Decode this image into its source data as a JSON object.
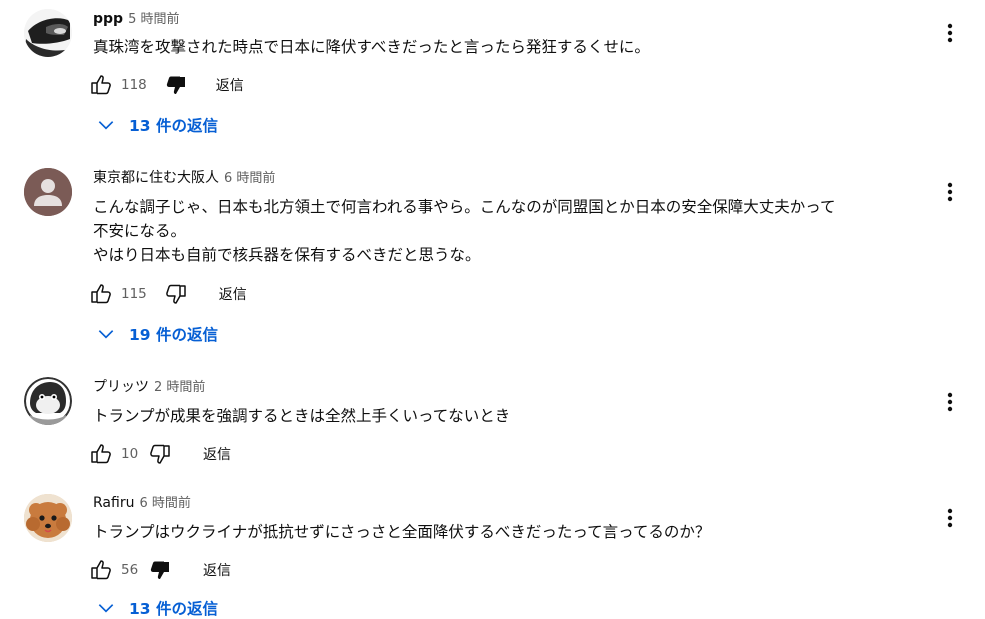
{
  "comments": [
    {
      "author": "ppp",
      "time": "5 時間前",
      "lines": [
        "真珠湾を攻撃された時点で日本に降伏すべきだったと言ったら発狂するくせに。"
      ],
      "likes": "118",
      "dislike_active": true,
      "reply_label": "返信",
      "replies_label": "13 件の返信",
      "avatar_icon": "mask-avatar-icon"
    },
    {
      "author": "東京都に住む大阪人",
      "time": "6 時間前",
      "lines": [
        "こんな調子じゃ、日本も北方領土で何言われる事やら。こんなのが同盟国とか日本の安全保障大丈夫かって",
        "不安になる。",
        "やはり日本も自前で核兵器を保有するべきだと思うな。"
      ],
      "likes": "115",
      "dislike_active": false,
      "reply_label": "返信",
      "replies_label": "19 件の返信",
      "avatar_icon": "default-person-avatar-icon"
    },
    {
      "author": "プリッツ",
      "time": "2 時間前",
      "lines": [
        "トランプが成果を強調するときは全然上手くいってないとき"
      ],
      "likes": "10",
      "dislike_active": false,
      "reply_label": "返信",
      "avatar_icon": "penguin-avatar-icon"
    },
    {
      "author": "Rafiru",
      "time": "6 時間前",
      "lines": [
        "トランプはウクライナが抵抗せずにさっさと全面降伏するべきだったって言ってるのか？"
      ],
      "likes": "56",
      "dislike_active": true,
      "reply_label": "返信",
      "replies_label": "13 件の返信",
      "avatar_icon": "poodle-dog-avatar-icon"
    }
  ],
  "colors": {
    "link_blue": "#065fd4",
    "secondary_text": "#606060",
    "primary_text": "#0f0f0f"
  }
}
